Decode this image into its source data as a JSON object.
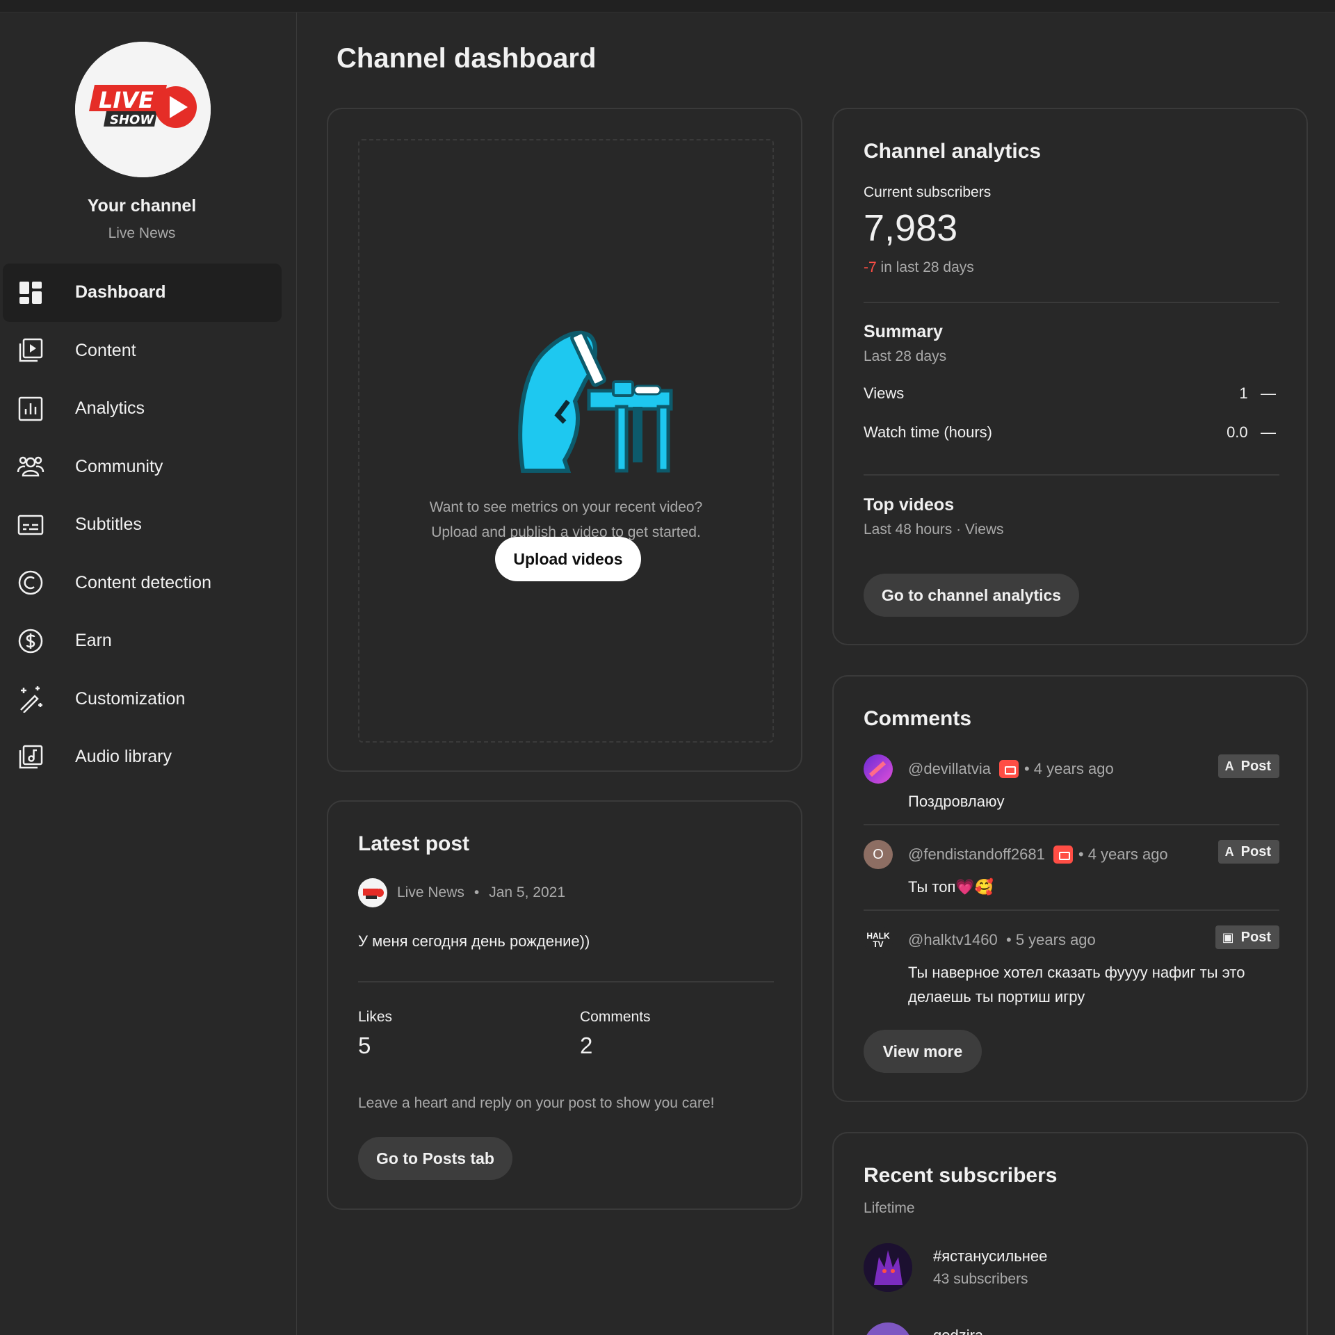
{
  "sidebar": {
    "channel_title": "Your channel",
    "channel_name": "Live News",
    "logo_text_top": "LIVE",
    "logo_text_bottom": "SHOW",
    "items": [
      {
        "label": "Dashboard",
        "icon": "dashboard-icon",
        "active": true
      },
      {
        "label": "Content",
        "icon": "content-icon"
      },
      {
        "label": "Analytics",
        "icon": "analytics-icon"
      },
      {
        "label": "Community",
        "icon": "community-icon"
      },
      {
        "label": "Subtitles",
        "icon": "subtitles-icon"
      },
      {
        "label": "Content detection",
        "icon": "copyright-icon"
      },
      {
        "label": "Earn",
        "icon": "dollar-icon"
      },
      {
        "label": "Customization",
        "icon": "magic-wand-icon"
      },
      {
        "label": "Audio library",
        "icon": "audio-library-icon"
      }
    ]
  },
  "main": {
    "page_title": "Channel dashboard",
    "upload": {
      "line1": "Want to see metrics on your recent video?",
      "line2": "Upload and publish a video to get started.",
      "button": "Upload videos"
    },
    "latest_post": {
      "title": "Latest post",
      "author": "Live News",
      "date": "Jan 5, 2021",
      "text": "У меня сегодня день рождение))",
      "likes_label": "Likes",
      "likes": "5",
      "comments_label": "Comments",
      "comments": "2",
      "hint": "Leave a heart and reply on your post to show you care!",
      "button": "Go to Posts tab"
    },
    "analytics": {
      "title": "Channel analytics",
      "subs_label": "Current subscribers",
      "subs_value": "7,983",
      "subs_change": "-7",
      "subs_change_suffix": " in last 28 days",
      "summary_title": "Summary",
      "summary_period": "Last 28 days",
      "views_label": "Views",
      "views_value": "1",
      "watch_label": "Watch time (hours)",
      "watch_value": "0.0",
      "trend_dash": "—",
      "top_title": "Top videos",
      "top_period": "Last 48 hours · Views",
      "button": "Go to channel analytics"
    },
    "comments": {
      "title": "Comments",
      "chip_label": "Post",
      "dot": "•",
      "items": [
        {
          "user": "@devillatvia",
          "time": "4 years ago",
          "text": "Поздровлаюу",
          "member": true
        },
        {
          "user": "@fendistandoff2681",
          "time": "4 years ago",
          "text": "Ты топ💗🥰",
          "avatar_letter": "O",
          "member": true
        },
        {
          "user": "@halktv1460",
          "time": "5 years ago",
          "text": "Ты наверное хотел сказать фуууу нафиг ты это делаешь ты портиш игру",
          "avatar_text": "HALK TV"
        }
      ],
      "button": "View more"
    },
    "subscribers": {
      "title": "Recent subscribers",
      "period": "Lifetime",
      "items": [
        {
          "name": "#ястанусильнее",
          "count": "43 subscribers"
        },
        {
          "name": "godzira",
          "count": ""
        }
      ]
    }
  },
  "colors": {
    "background": "#282828",
    "card_border": "#3a3a3a",
    "negative": "#ff4e45",
    "illustration": "#1ec8f0"
  }
}
